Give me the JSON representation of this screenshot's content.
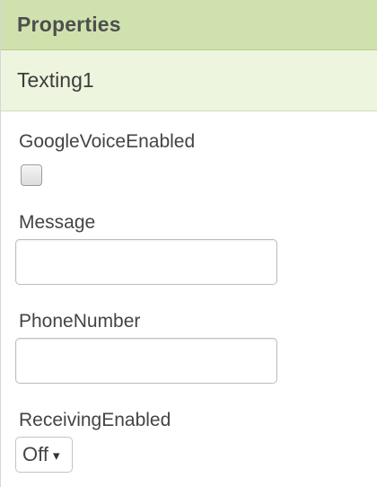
{
  "panel": {
    "title": "Properties",
    "component_name": "Texting1"
  },
  "properties": {
    "google_voice_enabled": {
      "label": "GoogleVoiceEnabled",
      "checked": false
    },
    "message": {
      "label": "Message",
      "value": ""
    },
    "phone_number": {
      "label": "PhoneNumber",
      "value": ""
    },
    "receiving_enabled": {
      "label": "ReceivingEnabled",
      "selected": "Off",
      "arrow_icon": "▾"
    }
  },
  "colors": {
    "header_bg": "#cfe2ad",
    "component_bar_bg": "#eef5df"
  }
}
